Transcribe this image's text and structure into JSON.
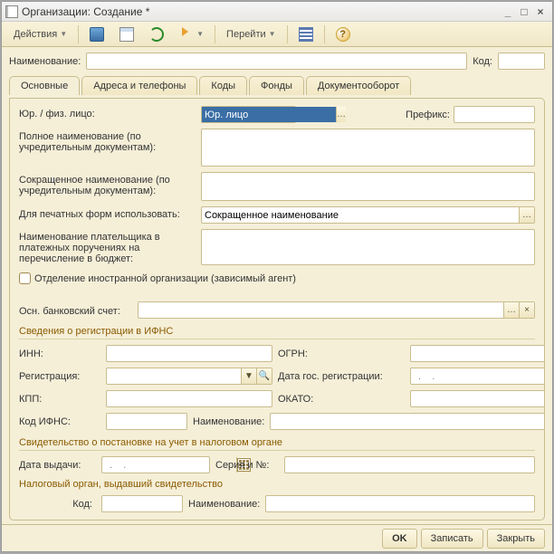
{
  "window": {
    "title": "Организации: Создание *"
  },
  "toolbar": {
    "actions": "Действия",
    "goto": "Перейти"
  },
  "header": {
    "name_label": "Наименование:",
    "code_label": "Код:"
  },
  "tabs": [
    {
      "label": "Основные"
    },
    {
      "label": "Адреса и телефоны"
    },
    {
      "label": "Коды"
    },
    {
      "label": "Фонды"
    },
    {
      "label": "Документооборот"
    }
  ],
  "main": {
    "entity_type_label": "Юр. / физ. лицо:",
    "entity_type_value": "Юр. лицо",
    "prefix_label": "Префикс:",
    "full_name_label": "Полное наименование (по учредительным документам):",
    "short_name_label": "Сокращенное наименование (по учредительным документам):",
    "print_forms_label": "Для печатных форм использовать:",
    "print_forms_value": "Сокращенное наименование",
    "payer_name_label": "Наименование плательщика в платежных поручениях на перечисление в бюджет:",
    "foreign_branch_label": "Отделение иностранной организации (зависимый агент)",
    "bank_account_label": "Осн. банковский счет:"
  },
  "ifns": {
    "section": "Сведения о регистрации в ИФНС",
    "inn": "ИНН:",
    "ogrn": "ОГРН:",
    "registration": "Регистрация:",
    "reg_date": "Дата гос. регистрации:",
    "reg_date_value": " .  .    ",
    "kpp": "КПП:",
    "okato": "ОКАТО:",
    "ifns_code": "Код ИФНС:",
    "ifns_name": "Наименование:"
  },
  "cert": {
    "section": "Свидетельство о постановке на учет в налоговом органе",
    "issue_date": "Дата выдачи:",
    "issue_date_value": " .  .    ",
    "series_no": "Серия и №:",
    "issuing_body": "Налоговый орган, выдавший свидетельство",
    "code": "Код:",
    "name": "Наименование:"
  },
  "footer": {
    "ok": "OK",
    "save": "Записать",
    "close": "Закрыть"
  }
}
